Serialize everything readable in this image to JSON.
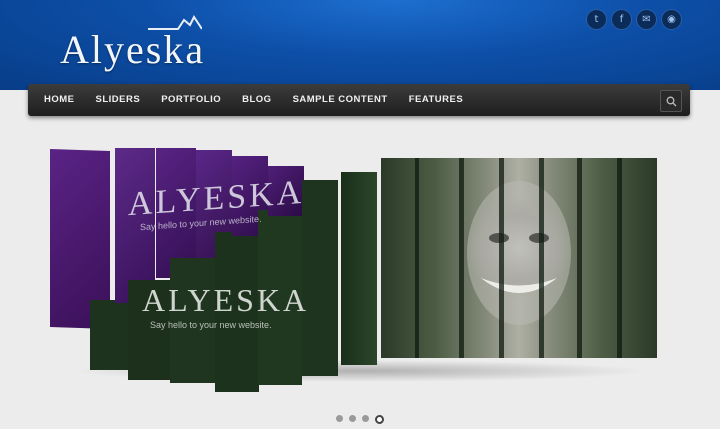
{
  "site": {
    "logo_text": "Alyeska"
  },
  "social": [
    {
      "icon": "twitter-icon",
      "glyph": "t"
    },
    {
      "icon": "facebook-icon",
      "glyph": "f"
    },
    {
      "icon": "email-icon",
      "glyph": "✉"
    },
    {
      "icon": "rss-icon",
      "glyph": "◉"
    }
  ],
  "nav": {
    "items": [
      "Home",
      "Sliders",
      "Portfolio",
      "Blog",
      "Sample Content",
      "Features"
    ]
  },
  "slider": {
    "slide_text_1": "ALYESKA",
    "slide_tagline": "Say hello to your new website.",
    "active_index": 3,
    "total_slides": 4
  },
  "colors": {
    "header_blue": "#0d4fa8",
    "purple": "#4a1a6e",
    "dark_green": "#1f3a1f"
  }
}
